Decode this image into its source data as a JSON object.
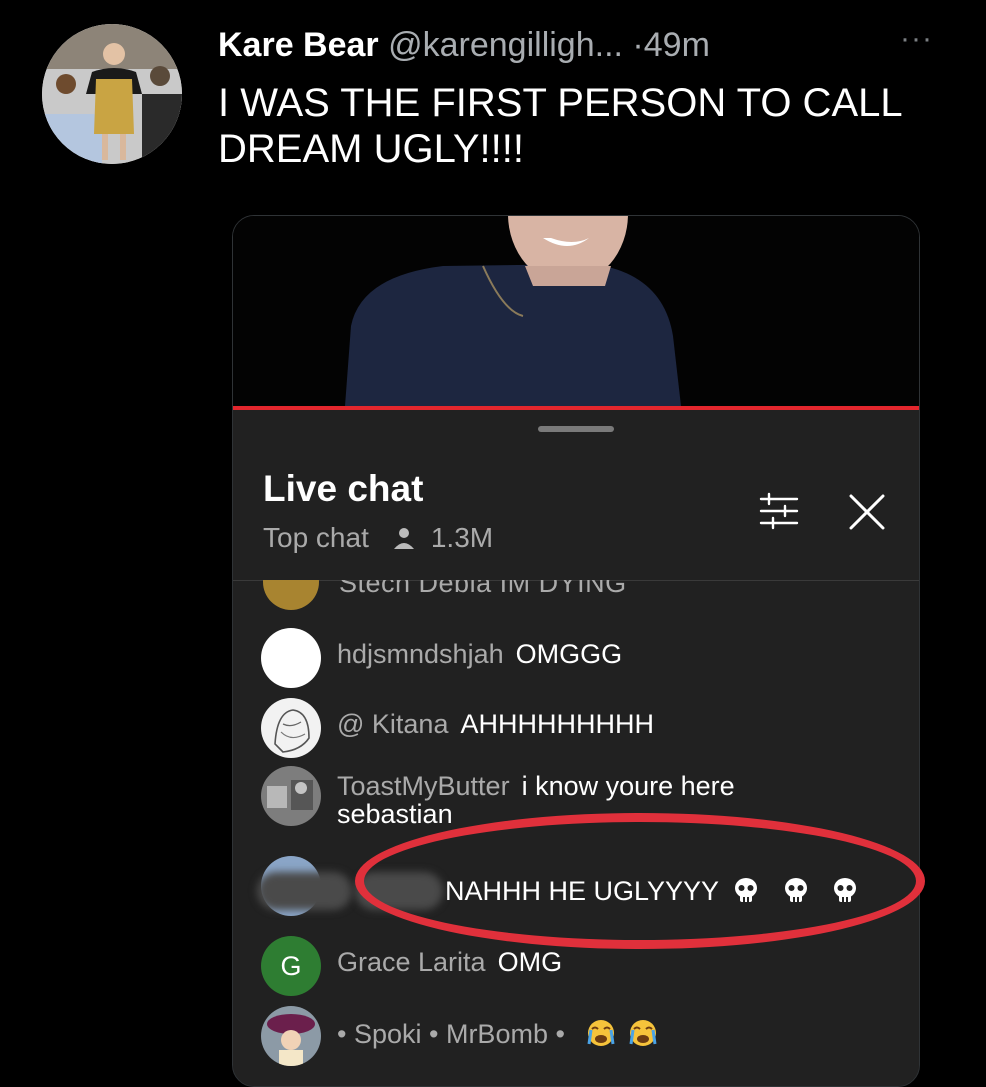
{
  "tweet": {
    "display_name": "Kare Bear",
    "handle": "@karengilligh...",
    "separator": "·",
    "time": "49m",
    "more": "···",
    "text": "I WAS THE FIRST PERSON TO CALL DREAM UGLY!!!!"
  },
  "live_chat": {
    "title": "Live chat",
    "mode": "Top chat",
    "viewer_count": "1.3M",
    "icons": {
      "viewers": "person-icon",
      "filter": "sliders-icon",
      "close": "close-icon"
    },
    "partial_message": "Stech Debia  IM DYING",
    "messages": [
      {
        "author": "hdjsmndshjah",
        "text": "OMGGG"
      },
      {
        "author": "@ Kitana",
        "text": "AHHHHHHHHH"
      },
      {
        "author": "ToastMyButter",
        "text": "i know youre here sebastian"
      },
      {
        "author": "",
        "text": "NAHHH HE UGLYYYY"
      },
      {
        "author": "Grace Larita",
        "text": "OMG"
      },
      {
        "author": "• Spoki • MrBomb •",
        "text": ""
      }
    ],
    "avatar_letter": "G"
  },
  "colors": {
    "background": "#000000",
    "chat_panel": "#212121",
    "progress_bar": "#e3262d",
    "highlight_circle": "#e0303b",
    "grace_avatar": "#2e7d32"
  }
}
